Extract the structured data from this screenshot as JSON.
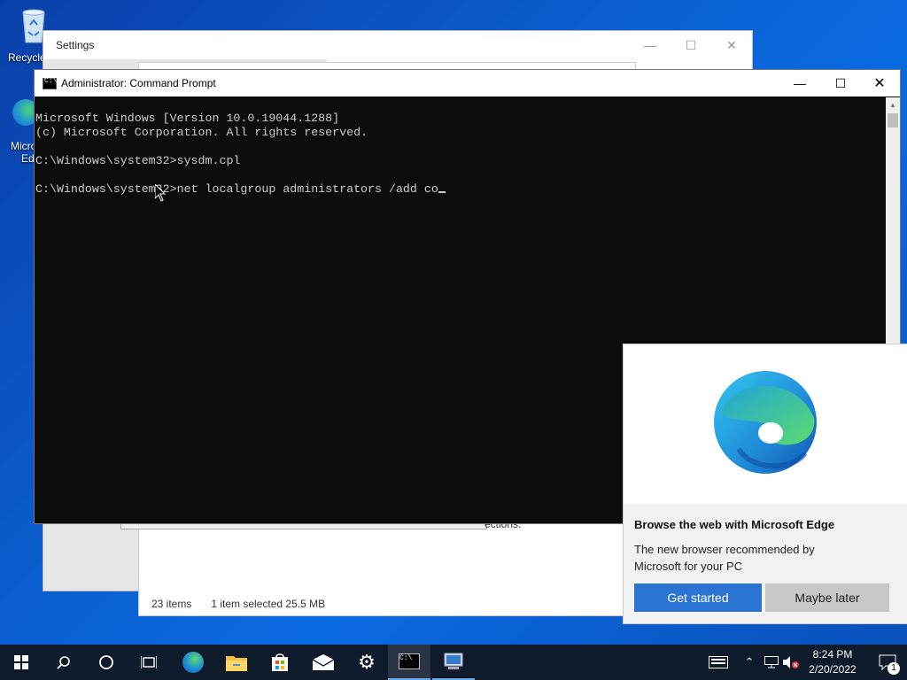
{
  "desktop": {
    "icons": [
      {
        "label": "Recycle",
        "icon": "recycle-bin-icon"
      },
      {
        "label": "Micro",
        "label2": "Ed",
        "icon": "edge-shortcut-icon"
      }
    ]
  },
  "settings_window": {
    "title": "Settings",
    "controls": {
      "minimize": "—",
      "maximize": "☐",
      "close": "✕"
    }
  },
  "explorer_window": {
    "status_items": "23 items",
    "status_selected": "1 item selected  25.5 MB"
  },
  "system_dialog": {
    "partial_text": "ections."
  },
  "cmd_window": {
    "title": "Administrator: Command Prompt",
    "controls": {
      "minimize": "—",
      "maximize": "☐",
      "close": "✕"
    },
    "lines": [
      "Microsoft Windows [Version 10.0.19044.1288]",
      "(c) Microsoft Corporation. All rights reserved.",
      "",
      "C:\\Windows\\system32>sysdm.cpl",
      "",
      "C:\\Windows\\system32>net localgroup administrators /add co"
    ]
  },
  "edge_popup": {
    "heading": "Browse the web with Microsoft Edge",
    "body": "The new browser recommended by Microsoft for your PC",
    "primary_button": "Get started",
    "secondary_button": "Maybe later"
  },
  "taskbar": {
    "items": [
      "windows-start-icon",
      "search-icon",
      "cortana-icon",
      "task-view-icon",
      "edge-icon",
      "file-explorer-icon",
      "store-icon",
      "mail-icon",
      "settings-gear-icon",
      "command-prompt-icon",
      "system-properties-icon"
    ],
    "time": "8:24 PM",
    "date": "2/20/2022",
    "notification_count": "1"
  },
  "colors": {
    "accent": "#2b73d2",
    "taskbar": "#0f1a2a",
    "console_bg": "#0c0c0c",
    "console_fg": "#cccccc"
  }
}
